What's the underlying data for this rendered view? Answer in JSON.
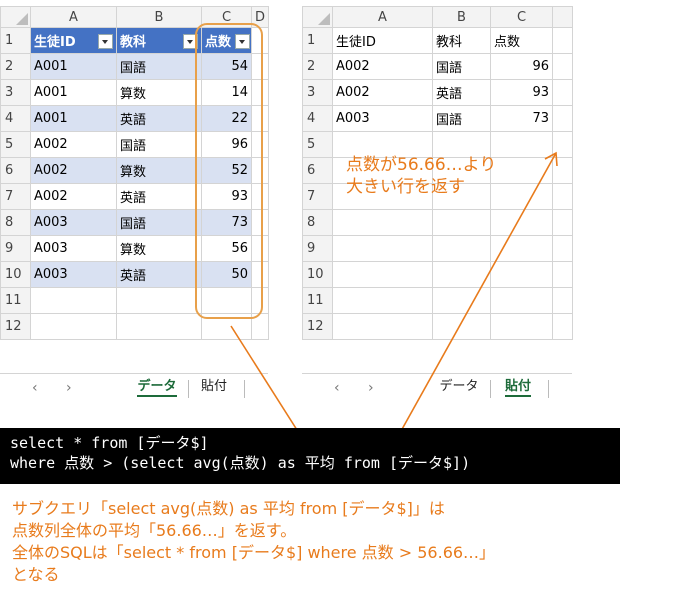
{
  "left_sheet": {
    "columns": [
      "A",
      "B",
      "C",
      "D"
    ],
    "header": [
      "生徒ID",
      "教科",
      "点数"
    ],
    "rows": [
      [
        "A001",
        "国語",
        "54"
      ],
      [
        "A001",
        "算数",
        "14"
      ],
      [
        "A001",
        "英語",
        "22"
      ],
      [
        "A002",
        "国語",
        "96"
      ],
      [
        "A002",
        "算数",
        "52"
      ],
      [
        "A002",
        "英語",
        "93"
      ],
      [
        "A003",
        "国語",
        "73"
      ],
      [
        "A003",
        "算数",
        "56"
      ],
      [
        "A003",
        "英語",
        "50"
      ]
    ],
    "row_numbers": [
      "1",
      "2",
      "3",
      "4",
      "5",
      "6",
      "7",
      "8",
      "9",
      "10",
      "11",
      "12"
    ],
    "tabs": [
      "データ",
      "貼付"
    ],
    "active_tab": "データ"
  },
  "right_sheet": {
    "columns": [
      "A",
      "B",
      "C"
    ],
    "header": [
      "生徒ID",
      "教科",
      "点数"
    ],
    "rows": [
      [
        "A002",
        "国語",
        "96"
      ],
      [
        "A002",
        "英語",
        "93"
      ],
      [
        "A003",
        "国語",
        "73"
      ]
    ],
    "row_numbers": [
      "1",
      "2",
      "3",
      "4",
      "5",
      "6",
      "7",
      "8",
      "9",
      "10",
      "11",
      "12"
    ],
    "tabs": [
      "データ",
      "貼付"
    ],
    "active_tab": "貼付"
  },
  "sql": {
    "line1": "select * from [データ$]",
    "line2": "where 点数 > (select avg(点数) as 平均 from [データ$])"
  },
  "note": {
    "line1": "点数が56.66…より",
    "line2": "大きい行を返す"
  },
  "caption": {
    "line1": "サブクエリ「select avg(点数) as 平均 from [データ$]」は",
    "line2": "点数列全体の平均「56.66…」を返す。",
    "line3": "全体のSQLは「select * from [データ$] where 点数 > 56.66…」",
    "line4": "となる"
  },
  "colors": {
    "accent": "#e87b1c",
    "table_header": "#4472c4",
    "band": "#d9e1f2",
    "active_tab": "#1d6b3a"
  }
}
